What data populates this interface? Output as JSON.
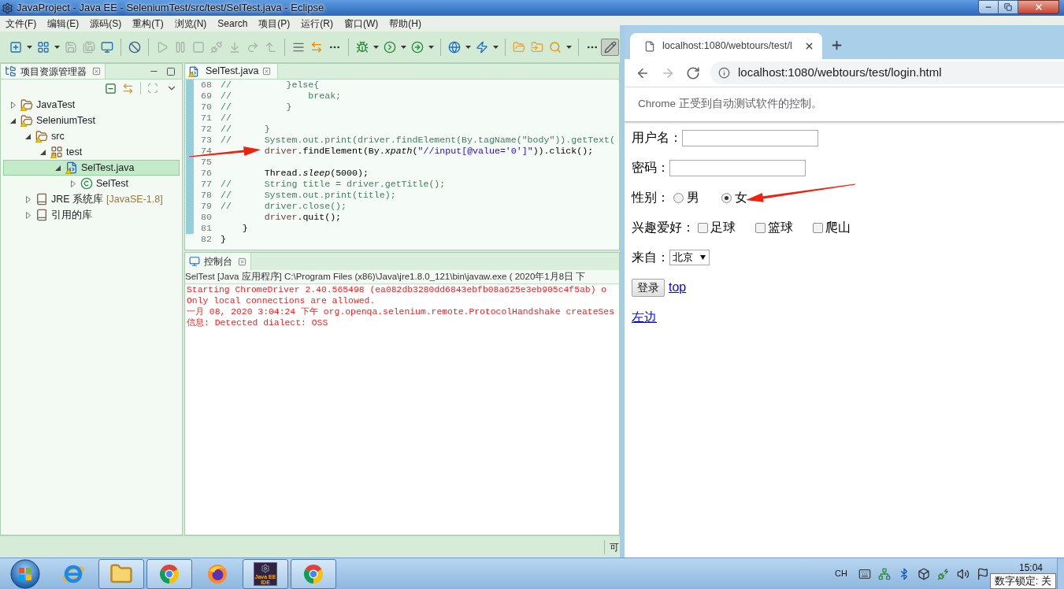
{
  "eclipse": {
    "title": "JavaProject - Java EE - SeleniumTest/src/test/SelTest.java - Eclipse",
    "menu": [
      "文件(F)",
      "编辑(E)",
      "源码(S)",
      "重构(T)",
      "浏览(N)",
      "Search",
      "项目(P)",
      "运行(R)",
      "窗口(W)",
      "帮助(H)"
    ],
    "toolbar": [
      [
        {
          "kind": "new",
          "dropdown": true,
          "disabled": false,
          "pressed": false
        },
        {
          "kind": "new_table",
          "dropdown": true,
          "disabled": false,
          "pressed": false
        },
        {
          "kind": "save",
          "dropdown": false,
          "disabled": true,
          "pressed": false
        },
        {
          "kind": "save_all",
          "dropdown": false,
          "disabled": true,
          "pressed": false
        },
        {
          "kind": "monitor",
          "dropdown": false,
          "disabled": false,
          "pressed": false
        }
      ],
      [
        {
          "kind": "skip_breakpoints",
          "dropdown": false,
          "disabled": false,
          "pressed": false
        }
      ],
      [
        {
          "kind": "resume",
          "dropdown": false,
          "disabled": true,
          "pressed": false
        },
        {
          "kind": "suspend",
          "dropdown": false,
          "disabled": true,
          "pressed": false
        },
        {
          "kind": "terminate",
          "dropdown": false,
          "disabled": true,
          "pressed": false
        },
        {
          "kind": "disconnect",
          "dropdown": false,
          "disabled": true,
          "pressed": false
        },
        {
          "kind": "step_into",
          "dropdown": false,
          "disabled": true,
          "pressed": false
        },
        {
          "kind": "step_over",
          "dropdown": false,
          "disabled": true,
          "pressed": false
        },
        {
          "kind": "step_return",
          "dropdown": false,
          "disabled": true,
          "pressed": false
        }
      ],
      [
        {
          "kind": "lines",
          "dropdown": false,
          "disabled": false,
          "pressed": false
        },
        {
          "kind": "swap",
          "dropdown": false,
          "disabled": false,
          "pressed": false
        },
        {
          "kind": "toggle_dots",
          "dropdown": false,
          "disabled": false,
          "pressed": false
        }
      ],
      [
        {
          "kind": "debug",
          "dropdown": true,
          "disabled": false,
          "pressed": false
        },
        {
          "kind": "run",
          "dropdown": true,
          "disabled": false,
          "pressed": false
        },
        {
          "kind": "external",
          "dropdown": true,
          "disabled": false,
          "pressed": false
        }
      ],
      [
        {
          "kind": "globe",
          "dropdown": true,
          "disabled": false,
          "pressed": false
        },
        {
          "kind": "spring",
          "dropdown": true,
          "disabled": false,
          "pressed": false
        }
      ],
      [
        {
          "kind": "folder_a",
          "dropdown": false,
          "disabled": false,
          "pressed": false
        },
        {
          "kind": "folder_b",
          "dropdown": false,
          "disabled": false,
          "pressed": false
        },
        {
          "kind": "search",
          "dropdown": true,
          "disabled": false,
          "pressed": false
        }
      ],
      [
        {
          "kind": "toggle_dots",
          "dropdown": false,
          "disabled": false,
          "pressed": false
        },
        {
          "kind": "pencil",
          "dropdown": false,
          "disabled": false,
          "pressed": true
        }
      ]
    ],
    "project_explorer": {
      "title": "项目资源管理器",
      "tree": [
        {
          "label": "JavaTest",
          "kind": "project",
          "warning": true,
          "expanded": false,
          "selected": false
        },
        {
          "label": "SeleniumTest",
          "kind": "project",
          "warning": true,
          "expanded": true,
          "selected": false,
          "children": [
            {
              "label": "src",
              "kind": "source_folder",
              "warning": true,
              "expanded": true,
              "selected": false,
              "children": [
                {
                  "label": "test",
                  "kind": "package",
                  "warning": true,
                  "expanded": true,
                  "selected": false,
                  "children": [
                    {
                      "label": "SelTest.java",
                      "kind": "java_file",
                      "warning": true,
                      "expanded": true,
                      "selected": true,
                      "children": [
                        {
                          "label": "SelTest",
                          "kind": "class",
                          "warning": false,
                          "expanded": false,
                          "selected": false
                        }
                      ]
                    }
                  ]
                }
              ]
            },
            {
              "label": "JRE 系统库",
              "decoration": "[JavaSE-1.8]",
              "kind": "library",
              "warning": false,
              "expanded": false,
              "selected": false
            },
            {
              "label": "引用的库",
              "kind": "library",
              "warning": false,
              "expanded": false,
              "selected": false
            }
          ]
        }
      ]
    },
    "editor": {
      "tab": "SelTest.java",
      "lines": [
        {
          "number": "68",
          "segments": [
            {
              "kind": "comment",
              "text": "//          }else{"
            }
          ]
        },
        {
          "number": "69",
          "segments": [
            {
              "kind": "comment",
              "text": "//              break;"
            }
          ]
        },
        {
          "number": "70",
          "segments": [
            {
              "kind": "comment",
              "text": "//          }"
            }
          ]
        },
        {
          "number": "71",
          "segments": [
            {
              "kind": "comment",
              "text": "//"
            }
          ]
        },
        {
          "number": "72",
          "segments": [
            {
              "kind": "comment",
              "text": "//      }"
            }
          ]
        },
        {
          "number": "73",
          "segments": [
            {
              "kind": "comment",
              "text": "//      System.out.print(driver.findElement(By.tagName(\"body\")).getText("
            }
          ]
        },
        {
          "number": "74",
          "segments": [
            {
              "kind": "variable",
              "text": "        driver"
            },
            {
              "kind": "plain",
              "text": ".findElement(By."
            },
            {
              "kind": "static",
              "text": "xpath"
            },
            {
              "kind": "plain",
              "text": "("
            },
            {
              "kind": "string",
              "text": "\"//input[@value='0']\""
            },
            {
              "kind": "plain",
              "text": ")).click();"
            }
          ]
        },
        {
          "number": "75"
        },
        {
          "number": "76",
          "segments": [
            {
              "kind": "plain",
              "text": "        Thread."
            },
            {
              "kind": "static",
              "text": "sleep"
            },
            {
              "kind": "plain",
              "text": "(5000);"
            }
          ]
        },
        {
          "number": "77",
          "segments": [
            {
              "kind": "comment",
              "text": "//      String title = driver.getTitle();"
            }
          ]
        },
        {
          "number": "78",
          "segments": [
            {
              "kind": "comment",
              "text": "//      System.out.print(title);"
            }
          ]
        },
        {
          "number": "79",
          "segments": [
            {
              "kind": "comment",
              "text": "//      driver.close();"
            }
          ]
        },
        {
          "number": "80",
          "segments": [
            {
              "kind": "variable",
              "text": "        driver"
            },
            {
              "kind": "plain",
              "text": ".quit();"
            }
          ]
        },
        {
          "number": "81",
          "segments": [
            {
              "kind": "plain",
              "text": "    }"
            }
          ]
        },
        {
          "number": "82",
          "segments": [
            {
              "kind": "plain",
              "text": "}"
            }
          ]
        }
      ]
    },
    "console": {
      "title": "控制台",
      "header": "SelTest [Java 应用程序] C:\\Program Files (x86)\\Java\\jre1.8.0_121\\bin\\javaw.exe ( 2020年1月8日 下",
      "lines": [
        "Starting ChromeDriver 2.40.565498 (ea082db3280dd6843ebfb08a625e3eb905c4f5ab) o",
        "Only local connections are allowed.",
        "一月 08, 2020 3:04:24 下午 org.openqa.selenium.remote.ProtocolHandshake createSes",
        "信息: Detected dialect: OSS"
      ]
    },
    "status_bar": {
      "text": "可"
    }
  },
  "chrome": {
    "tab_title": "localhost:1080/webtours/test/l",
    "navigation": [
      {
        "kind": "back",
        "disabled": false
      },
      {
        "kind": "forward",
        "disabled": true
      },
      {
        "kind": "reload",
        "disabled": false
      }
    ],
    "address": "localhost:1080/webtours/test/login.html",
    "infobar": "Chrome 正受到自动测试软件的控制。",
    "page": [
      {
        "kind": "text_field",
        "label": "用户名："
      },
      {
        "kind": "password_field",
        "label": "密码："
      },
      {
        "kind": "radio_group",
        "label": "性别：",
        "options": [
          {
            "label": "男",
            "selected": false
          },
          {
            "label": "女",
            "selected": true
          }
        ]
      },
      {
        "kind": "checkbox_group",
        "label": "兴趣爱好：",
        "options": [
          {
            "label": "足球",
            "checked": false
          },
          {
            "label": "篮球",
            "checked": false
          },
          {
            "label": "爬山",
            "checked": false
          }
        ]
      },
      {
        "kind": "select",
        "label": "来自：",
        "value": "北京"
      },
      {
        "kind": "button_link",
        "button": "登录",
        "link": "top"
      },
      {
        "kind": "link",
        "link": "左边"
      }
    ]
  },
  "taskbar": {
    "apps": [
      {
        "kind": "ie",
        "running": false
      },
      {
        "kind": "explorer",
        "running": true
      },
      {
        "kind": "chrome",
        "running": true
      },
      {
        "kind": "firefox",
        "running": false
      },
      {
        "kind": "ide",
        "running": true,
        "caption": "Java EE IDE"
      },
      {
        "kind": "chrome",
        "running": true
      }
    ],
    "tray": {
      "language": "CH",
      "clock": "15:04",
      "tooltip": "数字锁定: 关"
    }
  }
}
